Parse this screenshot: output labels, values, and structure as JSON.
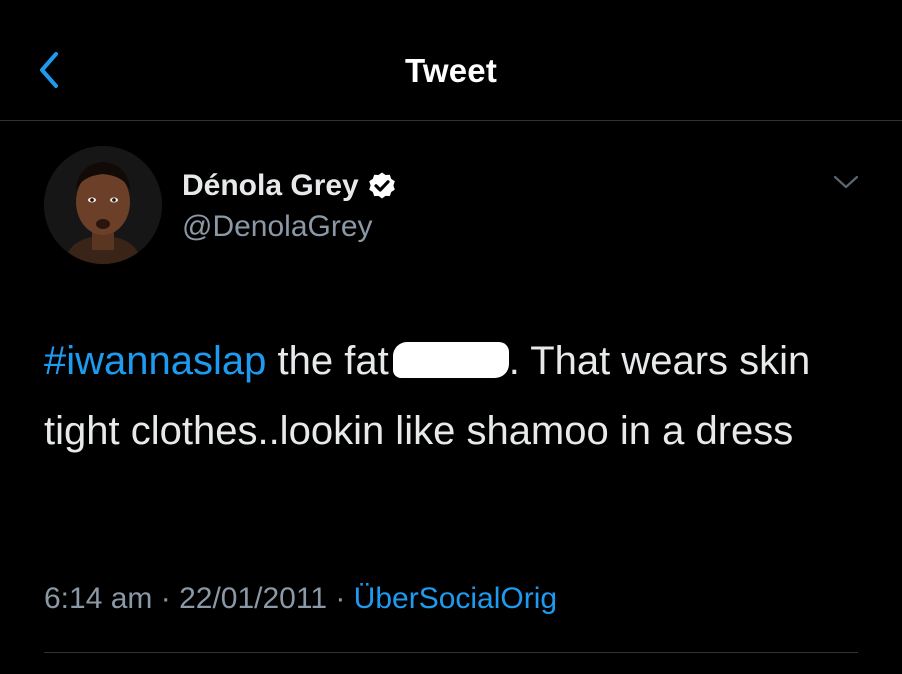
{
  "header": {
    "title": "Tweet",
    "back_icon": "chevron-left-icon"
  },
  "author": {
    "name": "Dénola Grey",
    "handle": "@DenolaGrey",
    "verified": true,
    "verified_icon": "verified-badge-icon"
  },
  "menu_icon": "chevron-down-icon",
  "tweet": {
    "hashtag": "#iwannaslap",
    "text_part1": " the fat",
    "text_part2": ". That wears skin tight clothes..lookin like shamoo in a dress",
    "redacted": true
  },
  "meta": {
    "time": "6:14 am",
    "separator": " · ",
    "date": "22/01/2011",
    "source": "ÜberSocialOrig"
  },
  "colors": {
    "background": "#000000",
    "link": "#1d9bf0",
    "secondary_text": "#8b98a5",
    "divider": "#2f3336"
  }
}
